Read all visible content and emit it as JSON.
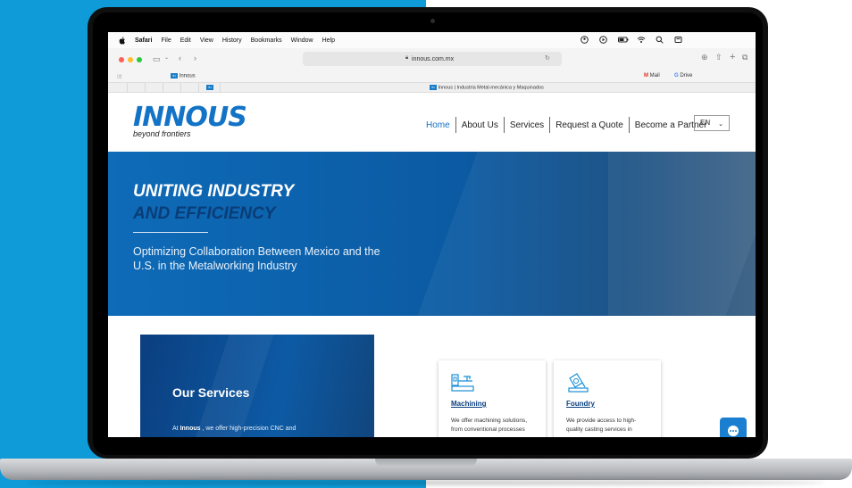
{
  "os_menubar": {
    "items": [
      "Safari",
      "File",
      "Edit",
      "View",
      "History",
      "Bookmarks",
      "Window",
      "Help"
    ]
  },
  "browser": {
    "url": "innous.com.mx",
    "favorites": {
      "tab_label": "Innous",
      "mail": "Mail",
      "drive": "Drive"
    },
    "active_tab_title": "Innous | Industria Metal-mecánica y Maquinados"
  },
  "header": {
    "logo": "INNOUS",
    "tagline": "beyond frontiers",
    "nav": [
      "Home",
      "About Us",
      "Services",
      "Request a Quote",
      "Become a Partner"
    ],
    "language": "EN"
  },
  "hero": {
    "title_line1": "UNITING INDUSTRY",
    "title_line2": "AND EFFICIENCY",
    "subtitle": "Optimizing Collaboration Between Mexico and the U.S. in the Metalworking Industry"
  },
  "services": {
    "title": "Our Services",
    "intro_prefix": "At",
    "intro_brand": "Innous",
    "intro_rest": ", we offer high-precision CNC and"
  },
  "cards": [
    {
      "title": "Machining",
      "desc": "We offer machining solutions, from conventional processes",
      "icon": "machining-icon"
    },
    {
      "title": "Foundry",
      "desc": "We provide access to high-quality casting services in",
      "icon": "foundry-icon"
    }
  ],
  "colors": {
    "page_blue": "#0e9bd8",
    "brand_blue": "#1273c7",
    "hero_dark": "#0a3d77"
  }
}
